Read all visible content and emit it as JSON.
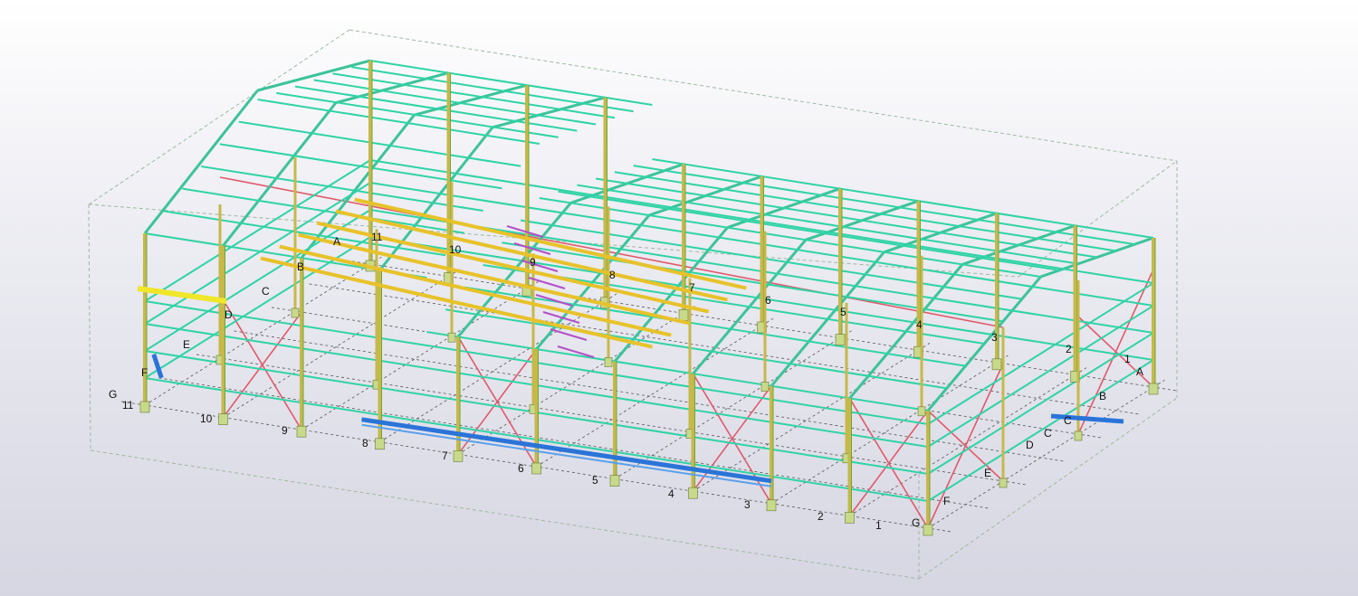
{
  "viewport": {
    "background_top": "#ffffff",
    "background_bottom": "#d6d6e2",
    "colors": {
      "purlin": "#2fd3a6",
      "column": "#c7b84a",
      "bracing": "#e05a6a",
      "crane_beam": "#2a74d8",
      "highlight": "#f0e62a",
      "pedestal": "#c8d98a",
      "stair": "#b44fc8",
      "gridline": "#555555",
      "bounding_box": "#9fb89f"
    }
  },
  "grid_labels": {
    "bottom_numbers": [
      "11",
      "10",
      "9",
      "8",
      "7",
      "6",
      "5",
      "4",
      "3",
      "2",
      "1"
    ],
    "right_letters": [
      "A",
      "B",
      "C",
      "D",
      "E",
      "F",
      "G"
    ],
    "right_letters_inner": [
      "C",
      "D",
      "E",
      "F",
      "G"
    ],
    "top_numbers": [
      "1",
      "2",
      "3",
      "4",
      "5",
      "6",
      "7",
      "8",
      "9",
      "10",
      "11"
    ],
    "top_letters": [
      "A",
      "B",
      "C",
      "D",
      "E",
      "F",
      "G"
    ],
    "left_letters": [
      "G",
      "F",
      "E",
      "D",
      "C"
    ]
  }
}
